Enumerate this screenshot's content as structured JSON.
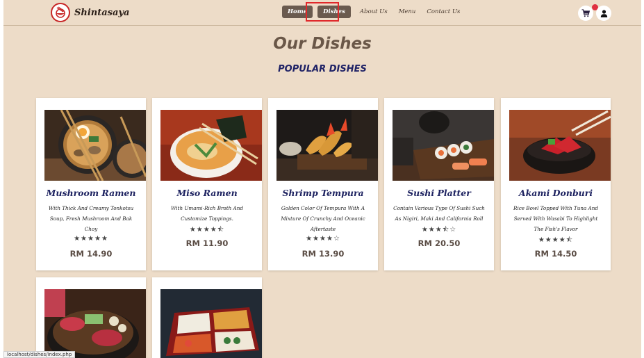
{
  "brand": {
    "name": "Shintasaya"
  },
  "nav": {
    "items": [
      {
        "label": "Home"
      },
      {
        "label": "Dishes"
      },
      {
        "label": "About Us"
      },
      {
        "label": "Menu"
      },
      {
        "label": "Contact Us"
      }
    ]
  },
  "page": {
    "title": "Our Dishes",
    "section": "POPULAR DISHES"
  },
  "dishes": [
    {
      "name": "Mushroom Ramen",
      "description": "With Thick And Creamy Tonkotsu Soup, Fresh Mushroom And Bak Choy",
      "rating": 5,
      "stars": "★★★★★",
      "price": "RM 14.90"
    },
    {
      "name": "Miso Ramen",
      "description": "With Umami-Rich Broth And Customize Toppings.",
      "rating": 4.5,
      "stars": "★★★★⯪",
      "price": "RM 11.90"
    },
    {
      "name": "Shrimp Tempura",
      "description": "Golden Color Of Tempura With A Mixture Of Crunchy And Oceanic Aftertaste",
      "rating": 4,
      "stars": "★★★★☆",
      "price": "RM 13.90"
    },
    {
      "name": "Sushi Platter",
      "description": "Contain Various Type Of Sushi Such As Nigiri, Maki And California Roll",
      "rating": 3.5,
      "stars": "★★★⯪☆",
      "price": "RM 20.50"
    },
    {
      "name": "Akami Donburi",
      "description": "Rice Bowl Topped With Tuna And Served With Wasabi To Highlight The Fish's Flavor",
      "rating": 4.5,
      "stars": "★★★★⯪",
      "price": "RM 14.50"
    }
  ],
  "status_bar": {
    "url": "localhost/dishes/index.php"
  },
  "colors": {
    "background": "#eddcc8",
    "nav_active": "#6a5a4e",
    "title": "#6a5748",
    "section_title": "#1f2266",
    "highlight": "#e0282a",
    "badge": "#e03040"
  }
}
